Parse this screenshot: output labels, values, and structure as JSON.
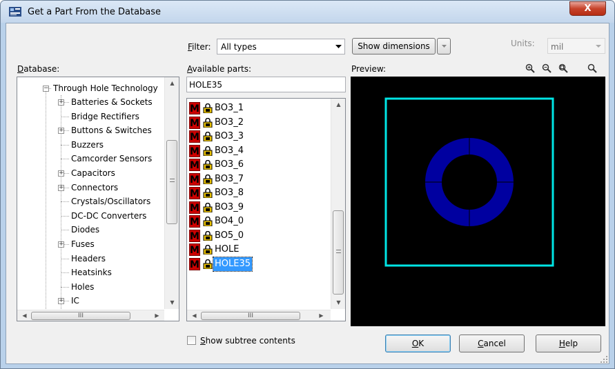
{
  "window": {
    "title": "Get a Part From the Database",
    "close_label": "X"
  },
  "filter": {
    "label": "Filter:",
    "label_underline": "F",
    "label_rest": "ilter:",
    "value": "All types"
  },
  "show_dimensions_label": "Show dimensions",
  "units": {
    "label": "Units:",
    "value": "mil"
  },
  "database": {
    "label": "Database:",
    "label_underline": "D",
    "label_rest": "atabase:",
    "tree": {
      "root": "Through Hole Technology",
      "items": [
        {
          "label": "Batteries & Sockets",
          "expandable": true
        },
        {
          "label": "Bridge Rectifiers",
          "expandable": false
        },
        {
          "label": "Buttons & Switches",
          "expandable": true
        },
        {
          "label": "Buzzers",
          "expandable": false
        },
        {
          "label": "Camcorder Sensors",
          "expandable": false
        },
        {
          "label": "Capacitors",
          "expandable": true
        },
        {
          "label": "Connectors",
          "expandable": true
        },
        {
          "label": "Crystals/Oscillators",
          "expandable": false
        },
        {
          "label": "DC-DC Converters",
          "expandable": false
        },
        {
          "label": "Diodes",
          "expandable": false
        },
        {
          "label": "Fuses",
          "expandable": true
        },
        {
          "label": "Headers",
          "expandable": false
        },
        {
          "label": "Heatsinks",
          "expandable": false
        },
        {
          "label": "Holes",
          "expandable": false
        },
        {
          "label": "IC",
          "expandable": true
        }
      ],
      "hscroll_grip": "III"
    }
  },
  "available": {
    "label": "Available parts:",
    "label_underline": "A",
    "label_rest": "vailable parts:",
    "search_value": "HOLE35",
    "parts": [
      "BO3_1",
      "BO3_2",
      "BO3_3",
      "BO3_4",
      "BO3_6",
      "BO3_7",
      "BO3_8",
      "BO3_9",
      "BO4_0",
      "BO5_0",
      "HOLE",
      "HOLE35"
    ],
    "selected": "HOLE35",
    "m_icon_text": "M",
    "hscroll_grip": "III"
  },
  "preview": {
    "label": "Preview:",
    "outline_color": "#00e5e5",
    "pad_color": "#0000a0",
    "background": "#000000"
  },
  "zoom_icons": [
    "zoom-fit-icon",
    "zoom-out-icon",
    "zoom-in-icon",
    "zoom-search-icon"
  ],
  "show_subtree": {
    "label": "Show subtree contents",
    "label_underline": "S",
    "label_rest": "how subtree contents",
    "checked": false
  },
  "buttons": {
    "ok": {
      "label": "OK",
      "underline": "O",
      "rest": "K"
    },
    "cancel": {
      "label": "Cancel",
      "underline": "C",
      "rest": "ancel"
    },
    "help": {
      "label": "Help",
      "underline": "H",
      "rest": "elp"
    }
  }
}
